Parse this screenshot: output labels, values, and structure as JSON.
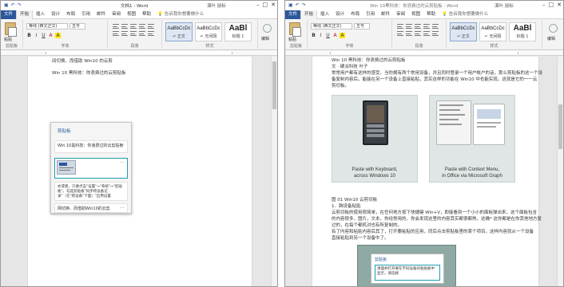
{
  "left_window": {
    "qat_icons": [
      "save-icon",
      "undo-icon",
      "redo-icon"
    ],
    "title": "文档1 - Word",
    "user": "漠叶 鼠标",
    "tabs": [
      "文件",
      "开始",
      "插入",
      "设计",
      "布局",
      "引用",
      "邮件",
      "审阅",
      "视图",
      "帮助"
    ],
    "tell_me": "告诉我你想要做什么",
    "ribbon": {
      "paste_label": "粘贴",
      "font_name": "等线 (西文正文)",
      "font_size": "五号",
      "format_buttons": [
        "B",
        "I",
        "U",
        "A",
        "A"
      ],
      "styles": [
        {
          "preview": "AaBbCcDc",
          "label": "↵ 正文"
        },
        {
          "preview": "AaBbCcDc",
          "label": "↵ 无间隔"
        },
        {
          "preview": "AaBl",
          "label": "标题 1"
        }
      ],
      "edit_label": "编辑",
      "groups": [
        "剪贴板",
        "字体",
        "段落",
        "样式"
      ]
    },
    "doc": {
      "line1": "间切换、而借助 Win10 的云剪",
      "line2": "Win 10 黑科技：你浪费过的云剪贴板"
    },
    "clipboard": {
      "header": "剪贴板",
      "items": [
        "Win 10黑科技：你浪费过的云剪贴板",
        "",
        "亦或者，只要点击\"设置\"→\"系统\"→\"剪贴板\"，勾选剪贴板\"同步跨设备记录\"（在\"跨设备\"下面）\"启用设置",
        "网切换、而借助Win10的云剪"
      ]
    }
  },
  "right_window": {
    "qat_icons": [
      "save-icon",
      "undo-icon",
      "redo-icon"
    ],
    "title": "Win 10黑科技：你浪费过的云剪贴板 - Word",
    "user": "漠叶 鼠标",
    "tabs": [
      "文件",
      "开始",
      "插入",
      "设计",
      "布局",
      "引用",
      "邮件",
      "审阅",
      "视图",
      "帮助"
    ],
    "tell_me": "告诉我你想要做什么",
    "ribbon": {
      "paste_label": "粘贴",
      "font_name": "等线 (西文正文)",
      "font_size": "五号",
      "format_buttons": [
        "B",
        "I",
        "U",
        "A",
        "A"
      ],
      "styles": [
        {
          "preview": "AaBbCcDc",
          "label": "↵ 正文"
        },
        {
          "preview": "AaBbCcDc",
          "label": "↵ 无间隔"
        },
        {
          "preview": "AaBl",
          "label": "标题 1"
        }
      ],
      "edit_label": "编辑",
      "groups": [
        "剪贴板",
        "字体",
        "段落",
        "样式"
      ]
    },
    "doc": {
      "heading": "Win 10 黑科技：你浪费过的云剪贴板",
      "author": "文 · 硬派科技 叶子",
      "para1": [
        "常常用户都有这样的感受，当你拥有两个常用设备，并且同时登录一个用户帐户的话，那么剪贴板的这一个设",
        "备复制内容后，能能在另一个设备上直接粘贴，其实这样的功能在 Win10 中也能实现，这就是它的一一云",
        "剪切板。"
      ],
      "figure": {
        "left_caption": [
          "Paste with Keyboard,",
          "across Windows 10"
        ],
        "right_caption": [
          "Paste with Context Menu,",
          "in Office via Microsoft Graph"
        ]
      },
      "fig_label": "图 01 Win10 云剪切板",
      "list1": "1．跨设备粘贴",
      "para2": [
        "云剪切板的使用很简单，在任何地方按下快捷键 Win+V，即能看到一个小小的面板弹出来，这个面板包含",
        "的内容很多，图片，文本，你经常用的，你会发现这里的内容其实都很都熟，这确* 这你都是在你其他地方复",
        "过的，在每个都机对也有所复制的。",
        "有了内容和粘贴内容后其了，打开要粘贴的应用，同后点击剪贴板里的某个项目，这样内容就从一个设备",
        "直接粘贴到另一个设备中了。"
      ],
      "clip_header": "剪贴板",
      "clip_text": "清理并打开要在不同设备的粘贴板中显示，请选择"
    }
  }
}
